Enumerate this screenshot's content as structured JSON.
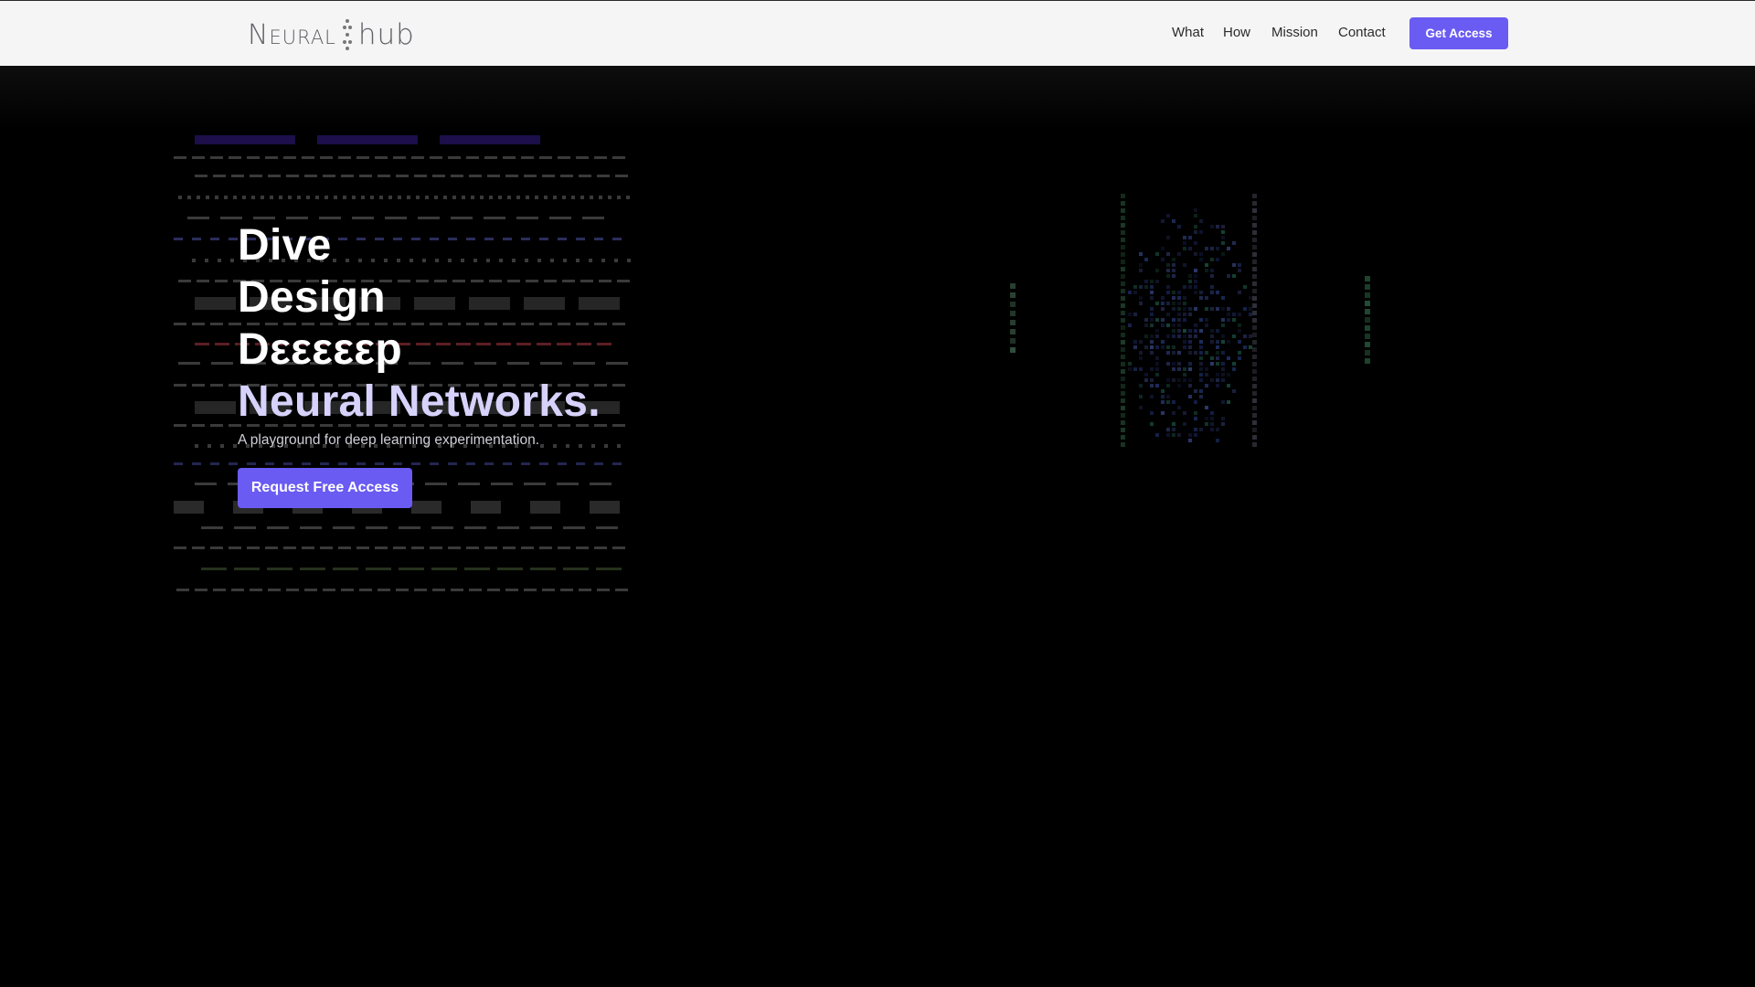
{
  "brand": {
    "logo_left": "Neural",
    "logo_right": "hub"
  },
  "nav": {
    "links": [
      "What",
      "How",
      "Mission",
      "Contact"
    ],
    "cta_label": "Get Access"
  },
  "hero": {
    "lines": [
      "Dive",
      "Design",
      "Dεεεεεp",
      "Neural Networks."
    ],
    "subtitle": "A playground for deep learning experimentation.",
    "cta_label": "Request Free Access"
  },
  "colors": {
    "accent": "#6a5bf2",
    "nav_bg": "#f5f5f5",
    "page_bg": "#000000",
    "hero_highlight": "#d7d2fb"
  }
}
